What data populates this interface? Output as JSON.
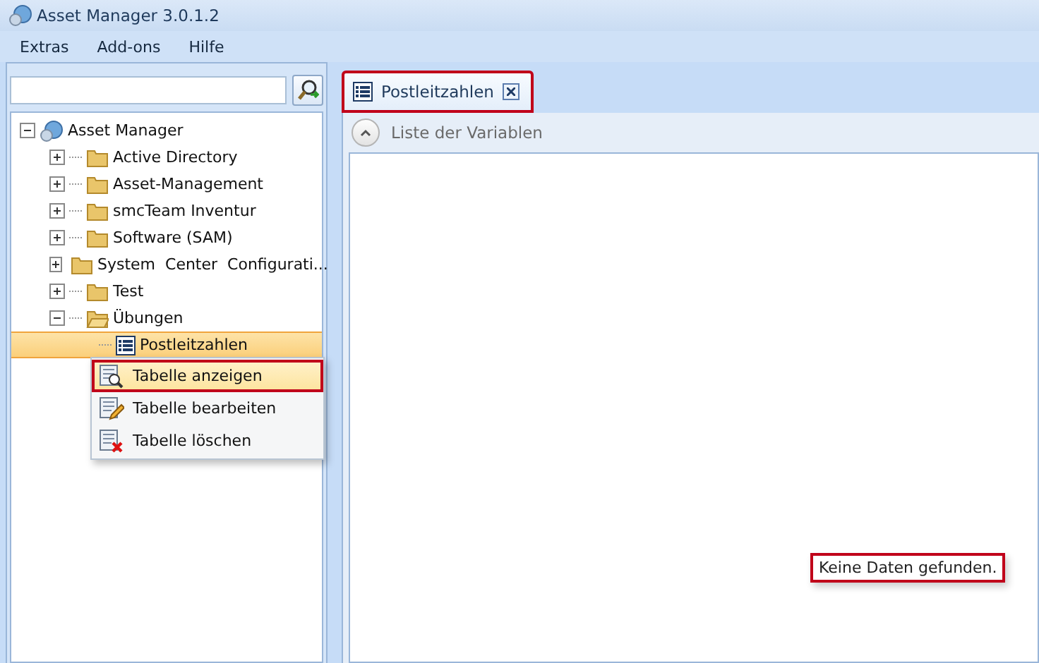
{
  "window": {
    "title": "Asset Manager 3.0.1.2"
  },
  "menu": [
    "Extras",
    "Add-ons",
    "Hilfe"
  ],
  "tree": [
    {
      "label": "Asset Manager",
      "kind": "root",
      "expanded": true,
      "selected": false,
      "children": [
        {
          "label": "Active Directory",
          "kind": "folder",
          "expanded": false,
          "selected": false
        },
        {
          "label": "Asset-Management",
          "kind": "folder",
          "expanded": false,
          "selected": false
        },
        {
          "label": "smcTeam Inventur",
          "kind": "folder",
          "expanded": false,
          "selected": false
        },
        {
          "label": "Software (SAM)",
          "kind": "folder",
          "expanded": false,
          "selected": false
        },
        {
          "label": "System  Center  Configurati...",
          "kind": "folder",
          "expanded": false,
          "selected": false
        },
        {
          "label": "Test",
          "kind": "folder",
          "expanded": false,
          "selected": false
        },
        {
          "label": "Übungen",
          "kind": "folder",
          "expanded": true,
          "selected": false,
          "children": [
            {
              "label": "Postleitzahlen",
              "kind": "table",
              "selected": true
            }
          ]
        }
      ]
    }
  ],
  "context_menu": [
    {
      "label": "Tabelle anzeigen",
      "kind": "view",
      "selected": true,
      "highlighted": true
    },
    {
      "label": "Tabelle bearbeiten",
      "kind": "edit",
      "selected": false,
      "highlighted": false
    },
    {
      "label": "Tabelle löschen",
      "kind": "delete",
      "selected": false,
      "highlighted": false
    }
  ],
  "tabs": [
    {
      "label": "Postleitzahlen",
      "selected": true,
      "highlighted": true
    }
  ],
  "panel": {
    "title": "Liste der Variablen",
    "expanded": true,
    "empty_message": "Keine Daten gefunden.",
    "message_highlighted": true
  }
}
